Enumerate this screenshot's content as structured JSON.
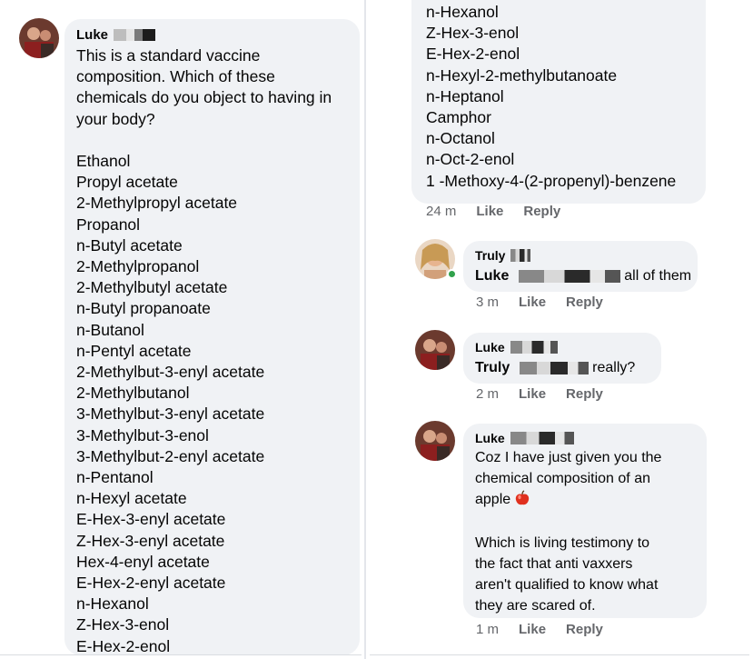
{
  "left_comment": {
    "author": "Luke",
    "intro_lines": [
      "This is a standard vaccine",
      "composition. Which of these",
      "chemicals do you object to having in",
      "your body?"
    ],
    "chemicals": [
      "Ethanol",
      "Propyl acetate",
      "2-Methylpropyl acetate",
      "Propanol",
      "n-Butyl acetate",
      "2-Methylpropanol",
      "2-Methylbutyl acetate",
      "n-Butyl propanoate",
      "n-Butanol",
      "n-Pentyl acetate",
      "2-Methylbut-3-enyl acetate",
      "2-Methylbutanol",
      "3-Methylbut-3-enyl acetate",
      "3-Methylbut-3-enol",
      "3-Methylbut-2-enyl acetate",
      "n-Pentanol",
      "n-Hexyl acetate",
      "E-Hex-3-enyl acetate",
      "Z-Hex-3-enyl acetate",
      "Hex-4-enyl acetate",
      "E-Hex-2-enyl acetate",
      "n-Hexanol",
      "Z-Hex-3-enol",
      "E-Hex-2-enol"
    ]
  },
  "right_comment": {
    "chemicals": [
      "n-Hexanol",
      "Z-Hex-3-enol",
      "E-Hex-2-enol",
      "n-Hexyl-2-methylbutanoate",
      "n-Heptanol",
      "Camphor",
      "n-Octanol",
      "n-Oct-2-enol",
      "1 -Methoxy-4-(2-propenyl)-benzene"
    ],
    "time": "24 m",
    "like_label": "Like",
    "reply_label": "Reply"
  },
  "replies": [
    {
      "author": "Truly",
      "mention": "Luke",
      "text": "all of them",
      "time": "3 m",
      "like_label": "Like",
      "reply_label": "Reply"
    },
    {
      "author": "Luke",
      "mention": "Truly",
      "text": "really?",
      "time": "2 m",
      "like_label": "Like",
      "reply_label": "Reply"
    },
    {
      "author": "Luke",
      "lines": [
        "Coz I have just given you the",
        "chemical composition of an",
        "apple",
        "",
        "Which is living testimony to",
        "the fact that anti vaxxers",
        "aren't qualified to know what",
        "they are scared of."
      ],
      "emoji": "apple-icon",
      "time": "1 m",
      "like_label": "Like",
      "reply_label": "Reply"
    }
  ],
  "colors": {
    "bubble": "#f0f2f5",
    "meta_text": "#65676b",
    "text": "#050505",
    "online": "#31a24c",
    "apple": "#e0301e"
  }
}
